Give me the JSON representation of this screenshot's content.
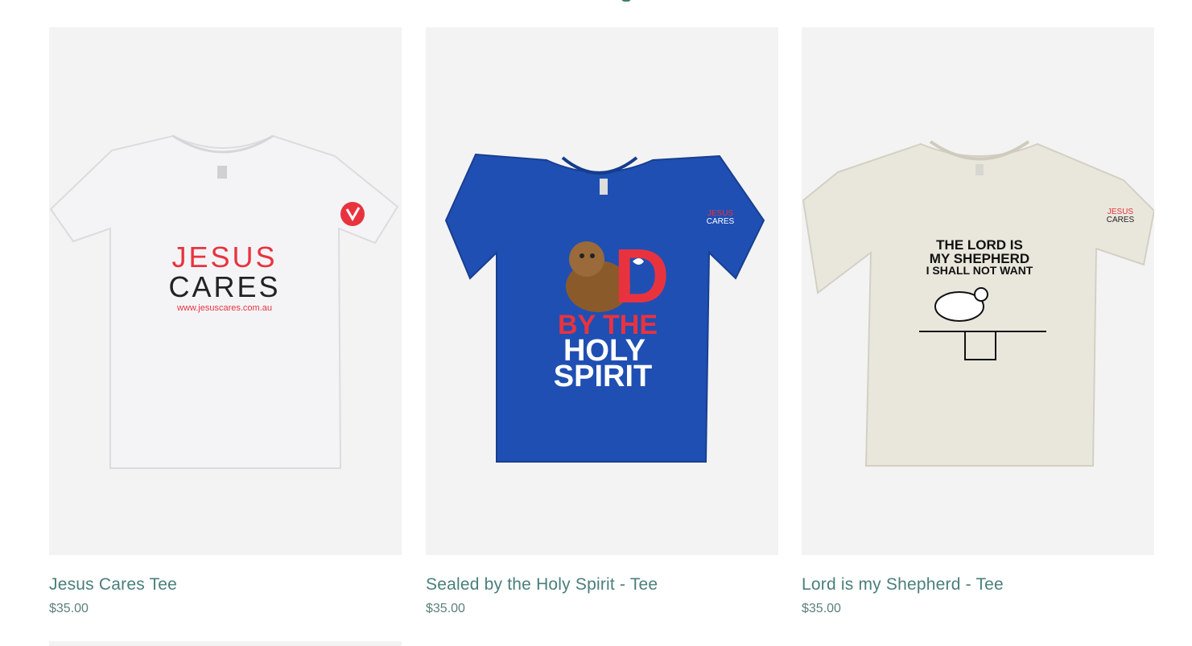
{
  "products": [
    {
      "name": "Jesus Cares Tee",
      "price": "$35.00",
      "shirt_color": "#f4f4f6",
      "print": {
        "line1": "JESUS",
        "line2": "CARES",
        "url": "www.jesuscares.com.au"
      }
    },
    {
      "name": "Sealed by the Holy Spirit - Tee",
      "price": "$35.00",
      "shirt_color": "#1f4fb3",
      "print": {
        "letter": "D",
        "line1": "BY THE",
        "line2": "HOLY",
        "line3": "SPIRIT",
        "sleeve_line1": "JESUS",
        "sleeve_line2": "CARES"
      }
    },
    {
      "name": "Lord is my Shepherd - Tee",
      "price": "$35.00",
      "shirt_color": "#e9e7dc",
      "print": {
        "line1": "THE LORD IS",
        "line2": "MY SHEPHERD",
        "line3": "I SHALL NOT WANT",
        "sleeve_line1": "JESUS",
        "sleeve_line2": "CARES"
      }
    }
  ],
  "colors": {
    "brand_red": "#e8333f",
    "title_teal": "#4a7f7b",
    "image_bg": "#f3f3f3"
  }
}
